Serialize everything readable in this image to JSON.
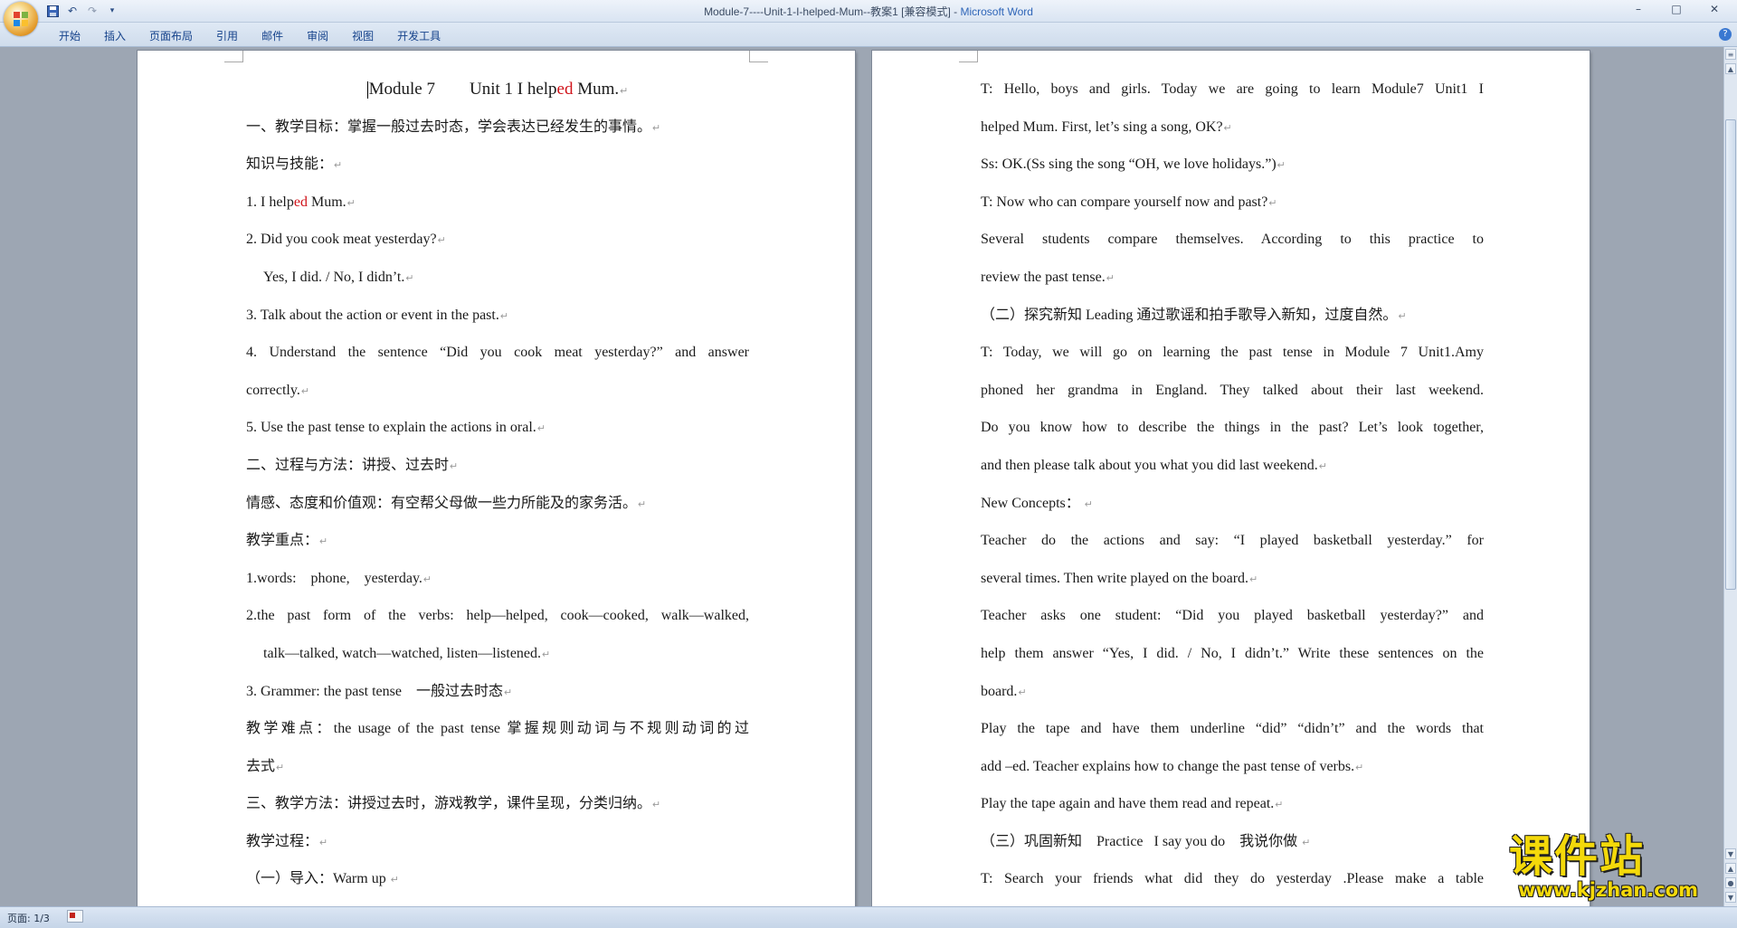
{
  "window": {
    "title": "Module-7----Unit-1-I-helped-Mum--教案1 [兼容模式] - ",
    "app_name": "Microsoft Word",
    "minimize": "–",
    "maximize": "□",
    "close": "✕"
  },
  "qat": {
    "save_icon": "save-icon",
    "undo_icon": "undo-icon",
    "redo_icon": "redo-icon",
    "customize_icon": "customize-icon"
  },
  "ribbon": {
    "tabs": [
      "开始",
      "插入",
      "页面布局",
      "引用",
      "邮件",
      "审阅",
      "视图",
      "开发工具"
    ],
    "help": "?"
  },
  "document": {
    "left_page": {
      "title_a": "Module 7",
      "title_b": "Unit 1 I help",
      "title_red": "ed",
      "title_c": " Mum.",
      "lines": [
        "一、教学目标：掌握一般过去时态，学会表达已经发生的事情。",
        "知识与技能：",
        "1. I help",
        "ed",
        " Mum.",
        "2. Did you cook meat yesterday?",
        "Yes, I did. / No, I didn’t.",
        "3. Talk about the action or event in the past.",
        "4. Understand the sentence “Did you cook meat yesterday?” and answer",
        "correctly.",
        "5. Use the past tense to explain the actions in oral.",
        "二、过程与方法：讲授、过去时",
        "情感、态度和价值观：有空帮父母做一些力所能及的家务活。",
        "教学重点：",
        "1.words:    phone,    yesterday.",
        "2.the past form of the verbs: help—helped, cook—cooked, walk—walked,",
        "talk—talked, watch—watched, listen—listened.",
        "3. Grammer: the past tense    一般过去时态",
        "教学难点：the usage of the past tense  掌握规则动词与不规则动词的过",
        "去式",
        "三、教学方法：讲授过去时，游戏教学，课件呈现，分类归纳。",
        "教学过程：",
        "（一）导入：Warm up "
      ]
    },
    "right_page": {
      "lines": [
        "T: Hello, boys and girls. Today we are going to learn Module7 Unit1 I",
        "helped Mum. First, let’s sing a song, OK?",
        "Ss: OK.(Ss sing the song “OH, we love holidays.”)",
        "T: Now who can compare yourself now and past?",
        "Several students compare themselves. According to this practice to",
        "review the past tense.",
        "（二）探究新知 Leading 通过歌谣和拍手歌导入新知，过度自然。",
        "T: Today, we will go on learning the past tense in Module 7 Unit1.Amy",
        "phoned her grandma in England. They talked about their last weekend.",
        "Do you know how to describe the things in the past? Let’s look together,",
        "and then please talk about you what you did last weekend.",
        "New Concepts： ",
        "Teacher do the actions and say: “I played basketball yesterday.” for",
        "several times. Then write played on the board.",
        "Teacher asks one student: “Did you played basketball yesterday?” and",
        "help them answer “Yes, I did. / No, I didn’t.” Write these sentences on the",
        "board.",
        "Play the tape and have them underline “did” “didn’t” and the words that",
        "add –ed. Teacher explains how to change the past tense of verbs.",
        "Play the tape again and have them read and repeat.",
        "（三）巩固新知    Practice   I say you do    我说你做 ",
        "T: Search your friends what did they do yesterday .Please make a table"
      ]
    },
    "paragraph_mark": "↵"
  },
  "status": {
    "page": "页面: 1/3"
  },
  "watermark": {
    "text": "课件站",
    "url": "www.kjzhan.com"
  }
}
